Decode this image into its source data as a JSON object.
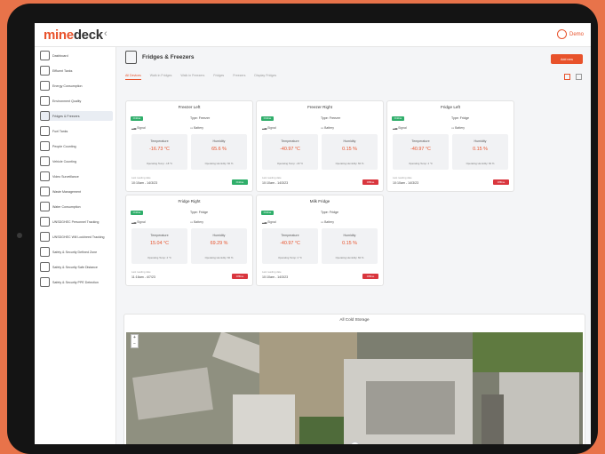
{
  "brand": {
    "part1": "mine",
    "part2": "deck"
  },
  "topbar": {
    "user": "Demo",
    "collapse_icon": "chevron-left-icon"
  },
  "sidebar": {
    "items": [
      {
        "label": "Dashboard",
        "icon": "dashboard-icon"
      },
      {
        "label": "Effluent Tanks",
        "icon": "tank-icon"
      },
      {
        "label": "Energy Consumption",
        "icon": "energy-icon"
      },
      {
        "label": "Environment Quality",
        "icon": "leaf-icon"
      },
      {
        "label": "Fridges & Freezers",
        "icon": "fridge-icon",
        "active": true
      },
      {
        "label": "Fuel Tanks",
        "icon": "fuel-icon"
      },
      {
        "label": "People Counting",
        "icon": "people-icon"
      },
      {
        "label": "Vehicle Counting",
        "icon": "vehicle-icon"
      },
      {
        "label": "Video Surveillance",
        "icon": "camera-icon"
      },
      {
        "label": "Waste Management",
        "icon": "bin-icon"
      },
      {
        "label": "Water Consumption",
        "icon": "water-icon"
      },
      {
        "label": "UNSDGHEC Personnel Tracking",
        "icon": "tracking-icon"
      },
      {
        "label": "UNSDGHEC Will Lockheed Tracking",
        "icon": "tracking-icon"
      },
      {
        "label": "Safety & Security Defined Zone",
        "icon": "shield-icon"
      },
      {
        "label": "Safety & Security Safe Distance",
        "icon": "shield-icon"
      },
      {
        "label": "Safety & Security PPE Detection",
        "icon": "shield-icon"
      }
    ]
  },
  "page": {
    "title": "Fridges & Freezers",
    "add_button": "Add new",
    "tabs": [
      "All Devices",
      "Walk in Fridges",
      "Walk in Freezers",
      "Fridges",
      "Freezers",
      "Display Fridges"
    ],
    "active_tab": 0
  },
  "cards": [
    {
      "title": "Freezer Left",
      "status": "Online",
      "type": "Type: Freezer",
      "signal": "Signal",
      "battery": "Battery",
      "temp_label": "Temperature",
      "temp": "-16.73 °C",
      "hum_label": "Humidity",
      "hum": "65.6 %",
      "temp_op": "Operating Temp: -18 °C",
      "hum_op": "Operating Humidity: 60 %",
      "last_label": "Last reading date",
      "last": "10:10am - 14/3/23",
      "badge": "Online",
      "badge_color": "#2fae6a"
    },
    {
      "title": "Freezer Right",
      "status": "Online",
      "type": "Type: Freezer",
      "signal": "Signal",
      "battery": "Battery",
      "temp_label": "Temperature",
      "temp": "-40.97 °C",
      "hum_label": "Humidity",
      "hum": "0.15 %",
      "temp_op": "Operating Temp: -18 °C",
      "hum_op": "Operating Humidity: 60 %",
      "last_label": "Last reading date",
      "last": "10:10am - 14/3/23",
      "badge": "Offline",
      "badge_color": "#d9363e"
    },
    {
      "title": "Fridge Left",
      "status": "Online",
      "type": "Type: Fridge",
      "signal": "Signal",
      "battery": "Battery",
      "temp_label": "Temperature",
      "temp": "-40.97 °C",
      "hum_label": "Humidity",
      "hum": "0.15 %",
      "temp_op": "Operating Temp: 4 °C",
      "hum_op": "Operating Humidity: 60 %",
      "last_label": "Last reading date",
      "last": "10:10am - 14/3/23",
      "badge": "Offline",
      "badge_color": "#d9363e"
    },
    {
      "title": "Fridge Right",
      "status": "Online",
      "type": "Type: Fridge",
      "signal": "Signal",
      "battery": "Battery",
      "temp_label": "Temperature",
      "temp": "15.04 °C",
      "hum_label": "Humidity",
      "hum": "69.29 %",
      "temp_op": "Operating Temp: 4 °C",
      "hum_op": "Operating Humidity: 60 %",
      "last_label": "Last reading date",
      "last": "11:16am - 4/7/23",
      "badge": "Offline",
      "badge_color": "#d9363e"
    },
    {
      "title": "Milk Fridge",
      "status": "Online",
      "type": "Type: Fridge",
      "signal": "Signal",
      "battery": "Battery",
      "temp_label": "Temperature",
      "temp": "-40.97 °C",
      "hum_label": "Humidity",
      "hum": "0.15 %",
      "temp_op": "Operating Temp: 4 °C",
      "hum_op": "Operating Humidity: 60 %",
      "last_label": "Last reading date",
      "last": "10:10am - 14/3/23",
      "badge": "Offline",
      "badge_color": "#d9363e"
    }
  ],
  "map": {
    "title": "All Cold Storage",
    "zoom_in": "+",
    "zoom_out": "−"
  }
}
